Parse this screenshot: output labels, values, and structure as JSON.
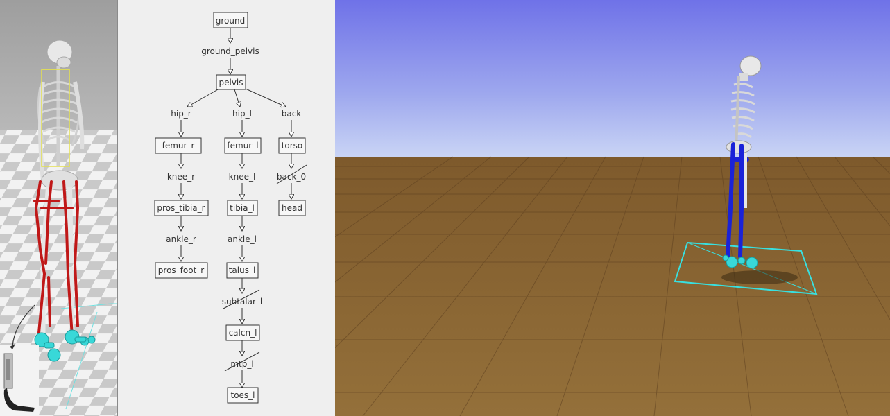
{
  "colors": {
    "node_text": "#333333",
    "highlight_text": "#e02020",
    "sky_top": "#6f72e8",
    "sky_bottom": "#c9d4f5",
    "ground": "#8b6330",
    "muscle": "#c01818",
    "bone": "#e8e8e8",
    "contact": "#38d8d8",
    "blue_segments": "#1a22d8"
  },
  "tree": {
    "bodies": {
      "ground": "ground",
      "pelvis": "pelvis",
      "femur_r": "femur_r",
      "femur_l": "femur_l",
      "torso": "torso",
      "pros_tibia_r": "pros_tibia_r",
      "tibia_l": "tibia_l",
      "head": "head",
      "pros_foot_r": "pros_foot_r",
      "talus_l": "talus_l",
      "calcn_l": "calcn_l",
      "toes_l": "toes_l"
    },
    "joints": {
      "ground_pelvis": "ground_pelvis",
      "hip_r": "hip_r",
      "hip_l": "hip_l",
      "back": "back",
      "knee_r": "knee_r",
      "knee_l": "knee_l",
      "back_0": "back_0",
      "ankle_r": "ankle_r",
      "ankle_l": "ankle_l",
      "subtalar_l": "subtalar_l",
      "mtp_l": "mtp_l"
    },
    "highlighted_body": "torso",
    "locked_joints": [
      "back_0",
      "subtalar_l",
      "mtp_l"
    ]
  },
  "left_view": {
    "icons": [
      "skeleton-model-icon",
      "prosthesis-icon"
    ]
  },
  "right_view": {
    "icons": [
      "skeleton-model-icon",
      "contact-plane-icon"
    ]
  }
}
